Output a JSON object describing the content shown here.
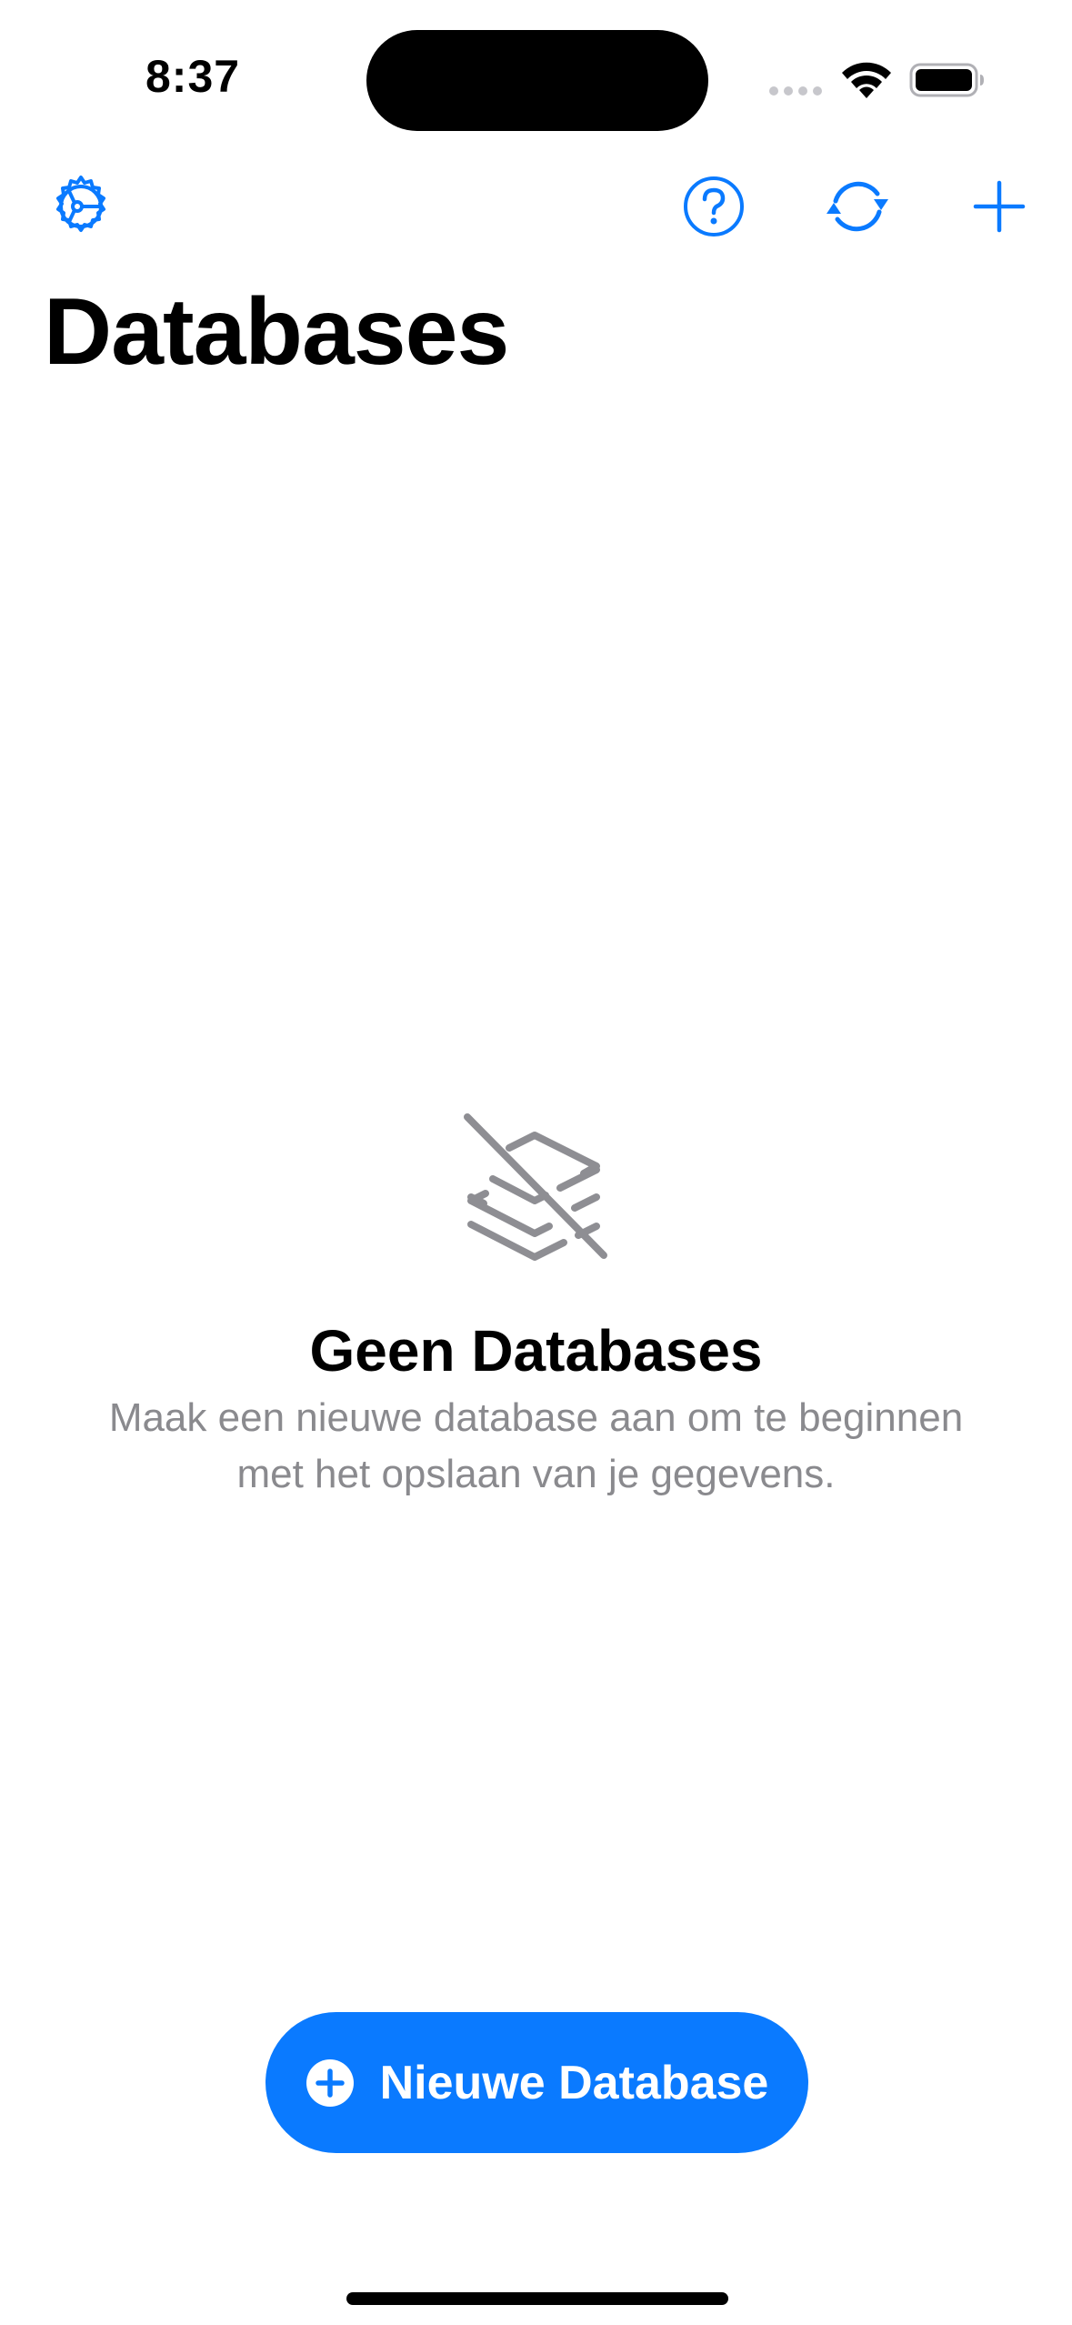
{
  "status_bar": {
    "time": "8:37"
  },
  "nav": {
    "settings_icon": "gear-icon",
    "help_icon": "question-circle-icon",
    "sync_icon": "sync-arrows-icon",
    "add_icon": "plus-icon"
  },
  "page": {
    "title": "Databases"
  },
  "empty_state": {
    "icon": "stack-slash-icon",
    "title": "Geen Databases",
    "description": "Maak een nieuwe database aan om te beginnen met het opslaan van je gegevens."
  },
  "primary_action": {
    "label": "Nieuwe Database",
    "icon": "plus-circle-icon"
  },
  "colors": {
    "accent": "#0a7aff",
    "secondary_text": "#8a8a8e",
    "icon_gray": "#8e8e93"
  }
}
